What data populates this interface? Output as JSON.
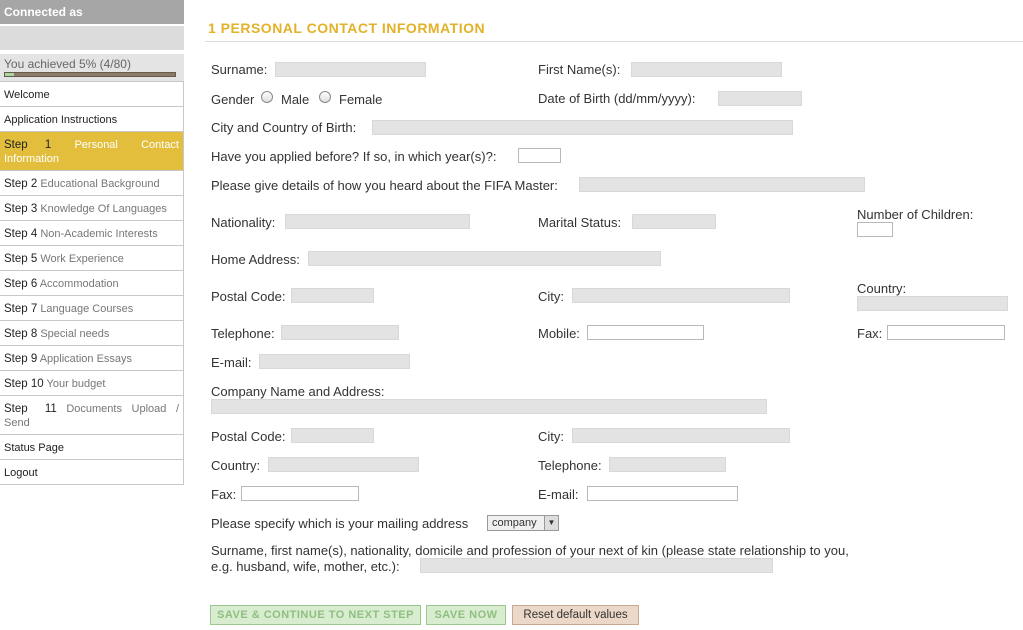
{
  "sidebar": {
    "connected_as": "Connected as",
    "progress_text": "You achieved 5% (4/80)",
    "progress_fraction": 0.05,
    "items": {
      "welcome": "Welcome",
      "instructions": "Application Instructions",
      "step1_num": "Step 1",
      "step1_word1": "Personal",
      "step1_word2": "Contact",
      "step1_word3": "Information",
      "step2_num": "Step 2",
      "step2_label": "Educational Background",
      "step3_num": "Step 3",
      "step3_label": "Knowledge Of Languages",
      "step4_num": "Step 4",
      "step4_label": "Non-Academic Interests",
      "step5_num": "Step 5",
      "step5_label": "Work Experience",
      "step6_num": "Step 6",
      "step6_label": "Accommodation",
      "step7_num": "Step 7",
      "step7_label": "Language Courses",
      "step8_num": "Step 8",
      "step8_label": "Special needs",
      "step9_num": "Step 9",
      "step9_label": "Application Essays",
      "step10_num": "Step 10",
      "step10_label": "Your budget",
      "step11_num": "Step 11",
      "step11_word1": "Documents",
      "step11_word2": "Upload",
      "step11_word3": "/",
      "step11_word4": "Send",
      "status": "Status Page",
      "logout": "Logout"
    }
  },
  "form": {
    "title": "1 PERSONAL CONTACT INFORMATION",
    "surname": "Surname:",
    "first_names": "First Name(s):",
    "gender": "Gender",
    "male": "Male",
    "female": "Female",
    "dob": "Date of Birth (dd/mm/yyyy):",
    "birth_place": "City and Country of Birth:",
    "applied_before": "Have you applied before? If so, in which year(s)?:",
    "heard_about": "Please give details of how you heard about the FIFA Master:",
    "nationality": "Nationality:",
    "marital": "Marital Status:",
    "children": "Number of Children:",
    "home_address": "Home Address:",
    "postal_code": "Postal Code:",
    "city": "City:",
    "country": "Country:",
    "telephone": "Telephone:",
    "mobile": "Mobile:",
    "fax": "Fax:",
    "email": "E-mail:",
    "company": "Company Name and Address:",
    "postal_code2": "Postal Code:",
    "city2": "City:",
    "country2": "Country:",
    "telephone2": "Telephone:",
    "fax2": "Fax:",
    "email2": "E-mail:",
    "mailing": "Please specify which is your mailing address",
    "mailing_value": "company",
    "kin_line1": "Surname, first name(s), nationality, domicile and profession of your next of kin (please state relationship to you,",
    "kin_line2": "e.g. husband, wife, mother, etc.):",
    "btn_save_continue": "SAVE & CONTINUE TO NEXT STEP",
    "btn_save_now": "SAVE NOW",
    "btn_reset": "Reset default values"
  }
}
